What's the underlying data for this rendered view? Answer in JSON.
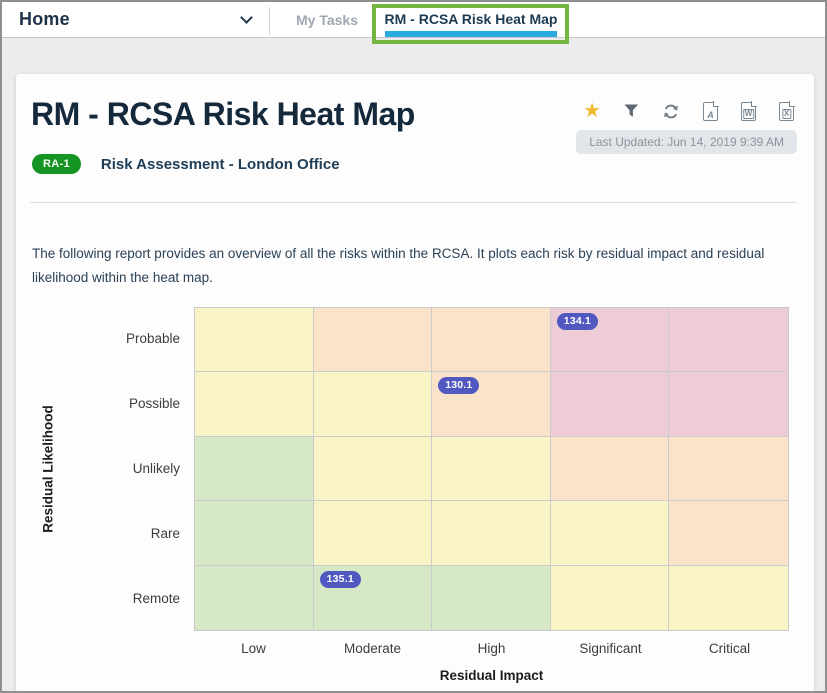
{
  "window": {
    "home_label": "Home",
    "my_tasks_label": "My Tasks",
    "active_tab_label": "RM - RCSA Risk Heat Map",
    "colors": {
      "tab_underline": "#29abe2",
      "annotation_green": "#75b73e"
    }
  },
  "report": {
    "title": "RM - RCSA Risk Heat Map",
    "badge_label": "RA-1",
    "subtitle": "Risk Assessment - London Office",
    "last_updated": "Last Updated: Jun 14, 2019 9:39 AM",
    "description": "The following report provides an overview of all the risks within the RCSA. It plots each risk by residual impact and residual likelihood within the heat map.",
    "toolbar": {
      "icons": [
        "favorite-star",
        "filter-funnel",
        "refresh",
        "export-pdf",
        "export-word",
        "export-excel"
      ],
      "pdf_letter": "A",
      "word_letter": "W",
      "excel_letter": "X"
    },
    "colors": {
      "badge_green": "#149422",
      "star_yellow": "#f1ba2e",
      "icon_gray": "#6e7983"
    }
  },
  "chart_data": {
    "type": "heatmap",
    "title": "",
    "xlabel": "Residual Impact",
    "ylabel": "Residual Likelihood",
    "x_categories": [
      "Low",
      "Moderate",
      "High",
      "Significant",
      "Critical"
    ],
    "y_categories": [
      "Probable",
      "Possible",
      "Unlikely",
      "Rare",
      "Remote"
    ],
    "grid": [
      [
        "yellow",
        "peach",
        "peach",
        "pink",
        "pink"
      ],
      [
        "yellow",
        "yellow",
        "peach",
        "pink",
        "pink"
      ],
      [
        "green",
        "yellow",
        "yellow",
        "peach",
        "peach"
      ],
      [
        "green",
        "yellow",
        "yellow",
        "yellow",
        "peach"
      ],
      [
        "green",
        "green",
        "green",
        "yellow",
        "yellow"
      ]
    ],
    "color_map": {
      "yellow": "#f8f4c5",
      "peach": "#fbe3ca",
      "pink": "#edccd6",
      "green": "#d6e8c5"
    },
    "points": [
      {
        "label": "134.1",
        "impact": "Significant",
        "likelihood": "Probable",
        "row": 0,
        "col": 3
      },
      {
        "label": "130.1",
        "impact": "High",
        "likelihood": "Possible",
        "row": 1,
        "col": 2
      },
      {
        "label": "135.1",
        "impact": "Moderate",
        "likelihood": "Remote",
        "row": 4,
        "col": 1
      }
    ],
    "point_color": "#5159c0",
    "gridline_color": "#cbcbce",
    "legend": "off",
    "gridlines": "on"
  }
}
